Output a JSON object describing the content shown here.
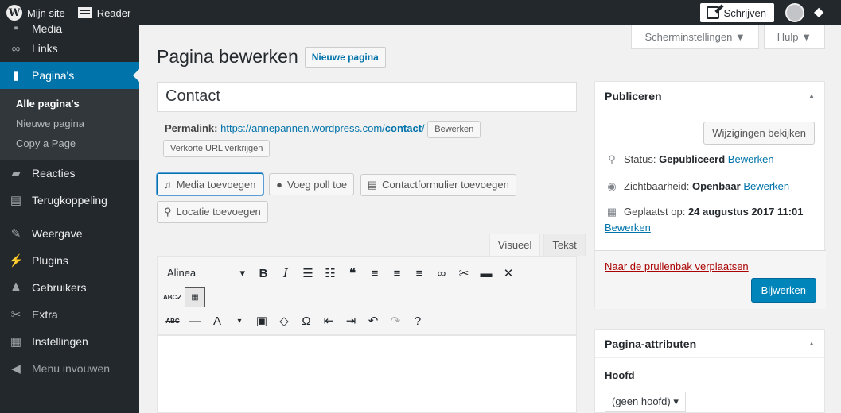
{
  "adminbar": {
    "my_site": "Mijn site",
    "reader": "Reader",
    "write": "Schrijven"
  },
  "sidebar": {
    "clipped_item": "Media",
    "items": [
      {
        "label": "Links",
        "icon": "links-icon"
      },
      {
        "label": "Pagina's",
        "icon": "pages-icon"
      },
      {
        "label": "Reacties",
        "icon": "comments-icon"
      },
      {
        "label": "Terugkoppeling",
        "icon": "feedback-icon"
      },
      {
        "label": "Weergave",
        "icon": "appearance-icon"
      },
      {
        "label": "Plugins",
        "icon": "plugins-icon"
      },
      {
        "label": "Gebruikers",
        "icon": "users-icon"
      },
      {
        "label": "Extra",
        "icon": "tools-icon"
      },
      {
        "label": "Instellingen",
        "icon": "settings-icon"
      },
      {
        "label": "Menu invouwen",
        "icon": "collapse-icon"
      }
    ],
    "submenu": [
      "Alle pagina's",
      "Nieuwe pagina",
      "Copy a Page"
    ]
  },
  "screen_options": {
    "screen": "Scherminstellingen ▼",
    "help": "Hulp ▼"
  },
  "page": {
    "title": "Pagina bewerken",
    "new_page": "Nieuwe pagina",
    "post_title": "Contact",
    "permalink_label": "Permalink:",
    "permalink_base": "https://annepannen.wordpress.com/",
    "permalink_slug": "contact",
    "permalink_end": "/",
    "edit_btn": "Bewerken",
    "shortlink_btn": "Verkorte URL verkrijgen"
  },
  "media_buttons": {
    "add_media": "Media toevoegen",
    "poll": "Voeg poll toe",
    "contact_form": "Contactformulier toevoegen",
    "location": "Locatie toevoegen"
  },
  "editor": {
    "tab_visual": "Visueel",
    "tab_text": "Tekst",
    "format_select": "Alinea"
  },
  "publish": {
    "title": "Publiceren",
    "preview": "Wijzigingen bekijken",
    "status_label": "Status:",
    "status_value": "Gepubliceerd",
    "visibility_label": "Zichtbaarheid:",
    "visibility_value": "Openbaar",
    "published_label": "Geplaatst op:",
    "published_value": "24 augustus 2017 11:01",
    "edit": "Bewerken",
    "trash": "Naar de prullenbak verplaatsen",
    "update": "Bijwerken"
  },
  "attributes": {
    "title": "Pagina-attributen",
    "parent_label": "Hoofd",
    "parent_value": "(geen hoofd) ▾"
  }
}
